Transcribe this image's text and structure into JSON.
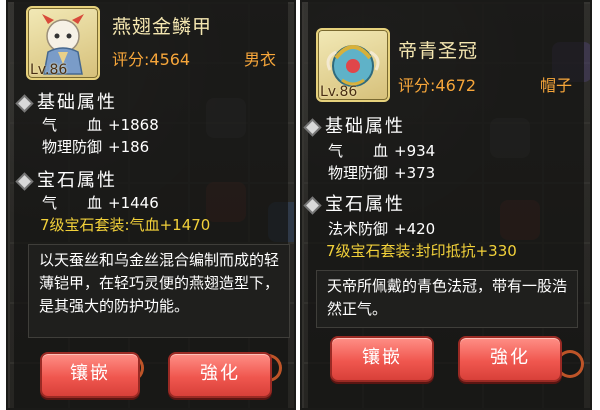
{
  "left_card": {
    "name": "燕翅金鳞甲",
    "level": "Lv.86",
    "score": "评分:4564",
    "slot": "男衣",
    "basic_title": "基础属性",
    "basic_stats": [
      {
        "key": "气　　血",
        "value": "+1868"
      },
      {
        "key": "物理防御",
        "value": "+186"
      }
    ],
    "gem_title": "宝石属性",
    "gem_stats": [
      {
        "key": "气　　血",
        "value": "+1446"
      }
    ],
    "gem_set": "7级宝石套装:气血+1470",
    "description": "以天蚕丝和乌金丝混合编制而成的轻薄铠甲，在轻巧灵便的燕翅造型下，是其强大的防护功能。",
    "btn_inlay": "镶嵌",
    "btn_enhance": "強化"
  },
  "right_card": {
    "name": "帝青圣冠",
    "level": "Lv.86",
    "score": "评分:4672",
    "slot": "帽子",
    "basic_title": "基础属性",
    "basic_stats": [
      {
        "key": "气　　血",
        "value": "+934"
      },
      {
        "key": "物理防御",
        "value": "+373"
      }
    ],
    "gem_title": "宝石属性",
    "gem_stats": [
      {
        "key": "法术防御",
        "value": "+420"
      }
    ],
    "gem_set": "7级宝石套装:封印抵抗+330",
    "description": "天帝所佩戴的青色法冠，带有一股浩然正气。",
    "btn_inlay": "镶嵌",
    "btn_enhance": "強化"
  },
  "colors": {
    "accent_orange": "#f7a63a",
    "gem_yellow": "#f2d13a",
    "button_red": "#f0574f"
  }
}
